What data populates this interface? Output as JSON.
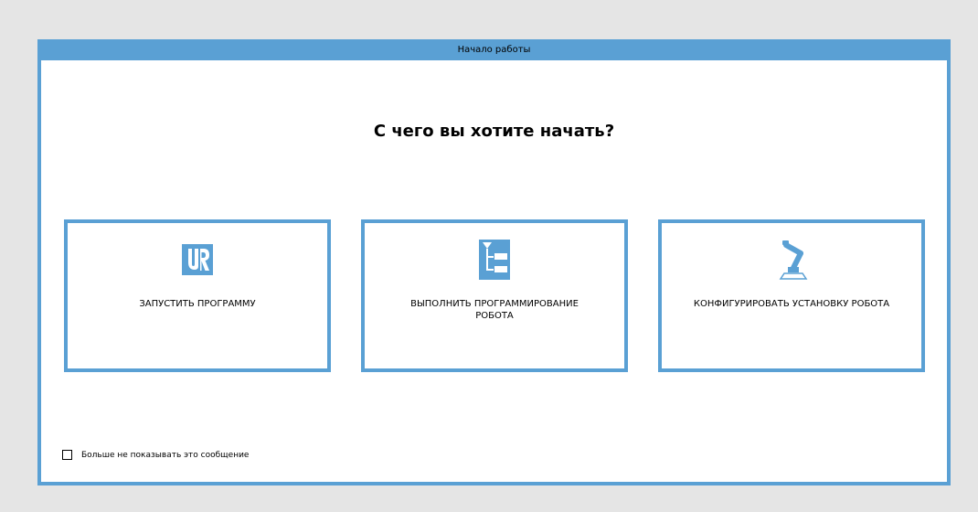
{
  "dialog": {
    "title": "Начало работы",
    "question": "С чего вы хотите начать?",
    "cards": [
      {
        "label_line1": "ЗАПУСТИТЬ ПРОГРАММУ",
        "label_line2": "",
        "icon": "ur-logo-icon"
      },
      {
        "label_line1": "ВЫПОЛНИТЬ ПРОГРАММИРОВАНИЕ",
        "label_line2": "РОБОТА",
        "icon": "program-tree-icon"
      },
      {
        "label_line1": "КОНФИГУРИРОВАТЬ УСТАНОВКУ РОБОТА",
        "label_line2": "",
        "icon": "robot-arm-icon"
      }
    ],
    "dont_show_label": "Больше не показывать это сообщение",
    "dont_show_checked": false
  },
  "colors": {
    "accent": "#5aa0d4",
    "background": "#e5e5e5",
    "panel": "#ffffff"
  }
}
